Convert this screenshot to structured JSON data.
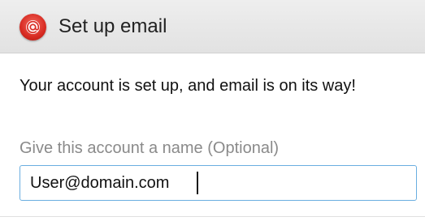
{
  "header": {
    "title": "Set up email",
    "icon": "email-app-icon",
    "icon_color": "#d82b22"
  },
  "main": {
    "message": "Your account is set up, and email is on its way!",
    "account_name_label": "Give this account a name (Optional)",
    "account_name_value": "User@domain.com"
  },
  "colors": {
    "header_background": "#e6e6e6",
    "input_border_focus": "#6aaee0",
    "label_text": "#8a8a8a"
  }
}
